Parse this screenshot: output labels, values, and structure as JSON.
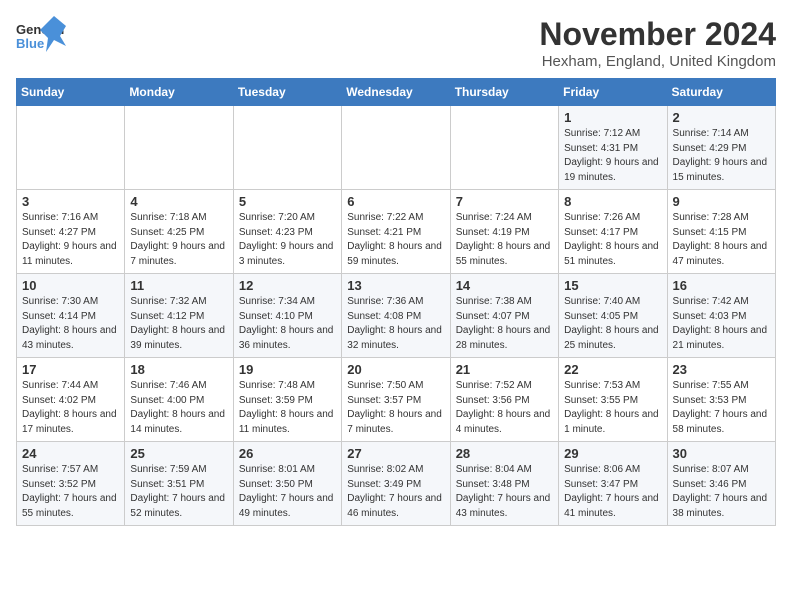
{
  "logo": {
    "line1": "General",
    "line2": "Blue"
  },
  "title": "November 2024",
  "subtitle": "Hexham, England, United Kingdom",
  "days_of_week": [
    "Sunday",
    "Monday",
    "Tuesday",
    "Wednesday",
    "Thursday",
    "Friday",
    "Saturday"
  ],
  "weeks": [
    [
      {
        "day": "",
        "info": ""
      },
      {
        "day": "",
        "info": ""
      },
      {
        "day": "",
        "info": ""
      },
      {
        "day": "",
        "info": ""
      },
      {
        "day": "",
        "info": ""
      },
      {
        "day": "1",
        "info": "Sunrise: 7:12 AM\nSunset: 4:31 PM\nDaylight: 9 hours and 19 minutes."
      },
      {
        "day": "2",
        "info": "Sunrise: 7:14 AM\nSunset: 4:29 PM\nDaylight: 9 hours and 15 minutes."
      }
    ],
    [
      {
        "day": "3",
        "info": "Sunrise: 7:16 AM\nSunset: 4:27 PM\nDaylight: 9 hours and 11 minutes."
      },
      {
        "day": "4",
        "info": "Sunrise: 7:18 AM\nSunset: 4:25 PM\nDaylight: 9 hours and 7 minutes."
      },
      {
        "day": "5",
        "info": "Sunrise: 7:20 AM\nSunset: 4:23 PM\nDaylight: 9 hours and 3 minutes."
      },
      {
        "day": "6",
        "info": "Sunrise: 7:22 AM\nSunset: 4:21 PM\nDaylight: 8 hours and 59 minutes."
      },
      {
        "day": "7",
        "info": "Sunrise: 7:24 AM\nSunset: 4:19 PM\nDaylight: 8 hours and 55 minutes."
      },
      {
        "day": "8",
        "info": "Sunrise: 7:26 AM\nSunset: 4:17 PM\nDaylight: 8 hours and 51 minutes."
      },
      {
        "day": "9",
        "info": "Sunrise: 7:28 AM\nSunset: 4:15 PM\nDaylight: 8 hours and 47 minutes."
      }
    ],
    [
      {
        "day": "10",
        "info": "Sunrise: 7:30 AM\nSunset: 4:14 PM\nDaylight: 8 hours and 43 minutes."
      },
      {
        "day": "11",
        "info": "Sunrise: 7:32 AM\nSunset: 4:12 PM\nDaylight: 8 hours and 39 minutes."
      },
      {
        "day": "12",
        "info": "Sunrise: 7:34 AM\nSunset: 4:10 PM\nDaylight: 8 hours and 36 minutes."
      },
      {
        "day": "13",
        "info": "Sunrise: 7:36 AM\nSunset: 4:08 PM\nDaylight: 8 hours and 32 minutes."
      },
      {
        "day": "14",
        "info": "Sunrise: 7:38 AM\nSunset: 4:07 PM\nDaylight: 8 hours and 28 minutes."
      },
      {
        "day": "15",
        "info": "Sunrise: 7:40 AM\nSunset: 4:05 PM\nDaylight: 8 hours and 25 minutes."
      },
      {
        "day": "16",
        "info": "Sunrise: 7:42 AM\nSunset: 4:03 PM\nDaylight: 8 hours and 21 minutes."
      }
    ],
    [
      {
        "day": "17",
        "info": "Sunrise: 7:44 AM\nSunset: 4:02 PM\nDaylight: 8 hours and 17 minutes."
      },
      {
        "day": "18",
        "info": "Sunrise: 7:46 AM\nSunset: 4:00 PM\nDaylight: 8 hours and 14 minutes."
      },
      {
        "day": "19",
        "info": "Sunrise: 7:48 AM\nSunset: 3:59 PM\nDaylight: 8 hours and 11 minutes."
      },
      {
        "day": "20",
        "info": "Sunrise: 7:50 AM\nSunset: 3:57 PM\nDaylight: 8 hours and 7 minutes."
      },
      {
        "day": "21",
        "info": "Sunrise: 7:52 AM\nSunset: 3:56 PM\nDaylight: 8 hours and 4 minutes."
      },
      {
        "day": "22",
        "info": "Sunrise: 7:53 AM\nSunset: 3:55 PM\nDaylight: 8 hours and 1 minute."
      },
      {
        "day": "23",
        "info": "Sunrise: 7:55 AM\nSunset: 3:53 PM\nDaylight: 7 hours and 58 minutes."
      }
    ],
    [
      {
        "day": "24",
        "info": "Sunrise: 7:57 AM\nSunset: 3:52 PM\nDaylight: 7 hours and 55 minutes."
      },
      {
        "day": "25",
        "info": "Sunrise: 7:59 AM\nSunset: 3:51 PM\nDaylight: 7 hours and 52 minutes."
      },
      {
        "day": "26",
        "info": "Sunrise: 8:01 AM\nSunset: 3:50 PM\nDaylight: 7 hours and 49 minutes."
      },
      {
        "day": "27",
        "info": "Sunrise: 8:02 AM\nSunset: 3:49 PM\nDaylight: 7 hours and 46 minutes."
      },
      {
        "day": "28",
        "info": "Sunrise: 8:04 AM\nSunset: 3:48 PM\nDaylight: 7 hours and 43 minutes."
      },
      {
        "day": "29",
        "info": "Sunrise: 8:06 AM\nSunset: 3:47 PM\nDaylight: 7 hours and 41 minutes."
      },
      {
        "day": "30",
        "info": "Sunrise: 8:07 AM\nSunset: 3:46 PM\nDaylight: 7 hours and 38 minutes."
      }
    ]
  ]
}
